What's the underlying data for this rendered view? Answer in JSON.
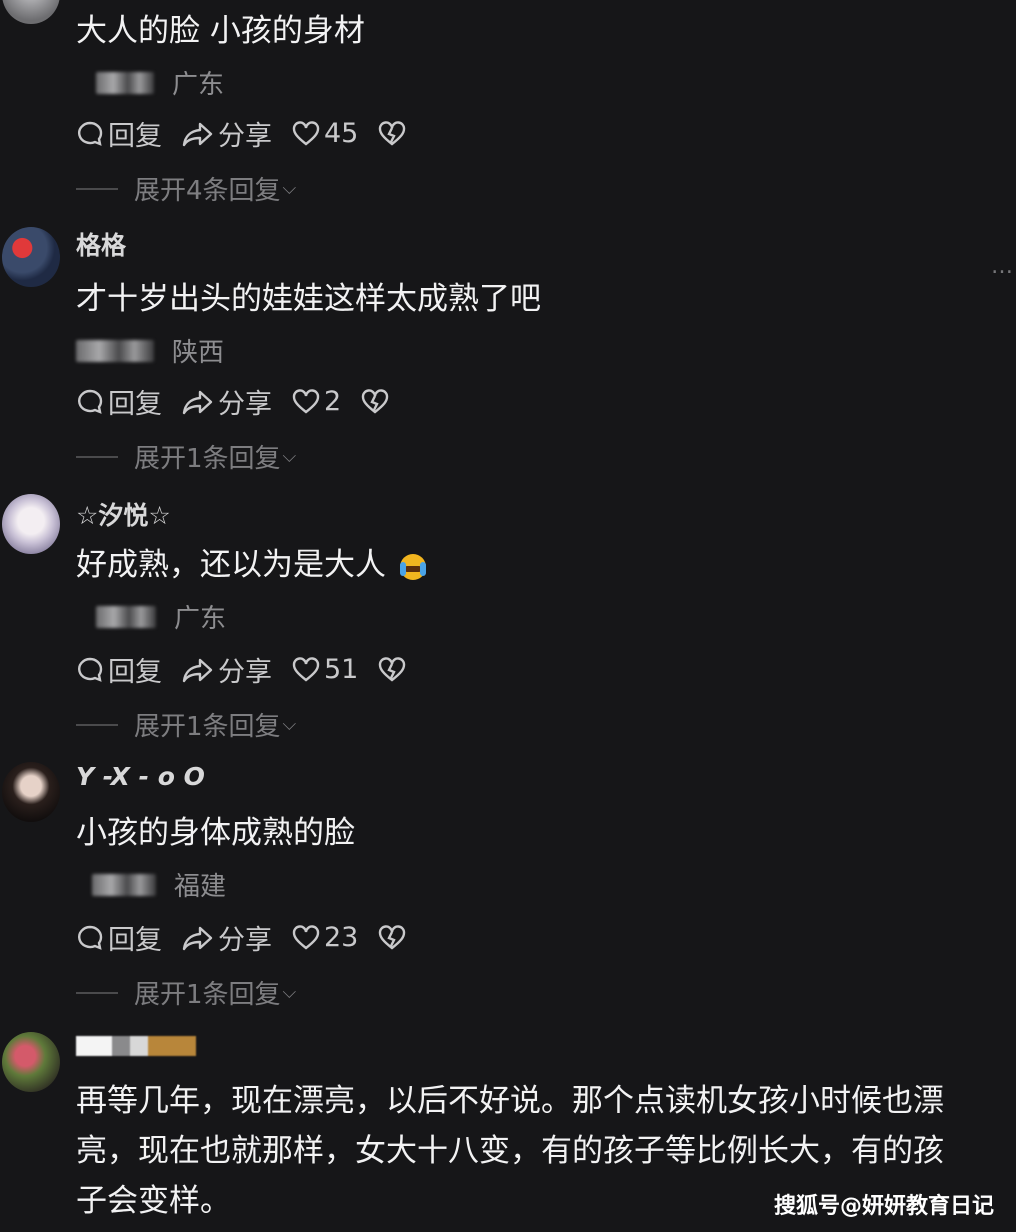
{
  "comments": [
    {
      "text": "大人的脸 小孩的身材",
      "location": "广东",
      "reply_label": "回复",
      "share_label": "分享",
      "likes": "45",
      "expand_label": "展开4条回复"
    },
    {
      "username": "格格",
      "text": "才十岁出头的娃娃这样太成熟了吧",
      "location": "陕西",
      "reply_label": "回复",
      "share_label": "分享",
      "likes": "2",
      "expand_label": "展开1条回复"
    },
    {
      "username": "☆汐悦☆",
      "text": "好成熟，还以为是大人",
      "location": "广东",
      "reply_label": "回复",
      "share_label": "分享",
      "likes": "51",
      "expand_label": "展开1条回复"
    },
    {
      "username": "Y -X - o O",
      "text": "小孩的身体成熟的脸",
      "location": "福建",
      "reply_label": "回复",
      "share_label": "分享",
      "likes": "23",
      "expand_label": "展开1条回复"
    },
    {
      "text_lines": [
        "再等几年，现在漂亮，以后不好说。那个点读机女孩小时候也漂",
        "亮，现在也就那样，女大十八变，有的孩子等比例长大，有的孩",
        "子会变样。"
      ]
    }
  ],
  "more_menu": "…",
  "expand_arrow": "⌵",
  "watermark": "搜狐号@妍妍教育日记"
}
